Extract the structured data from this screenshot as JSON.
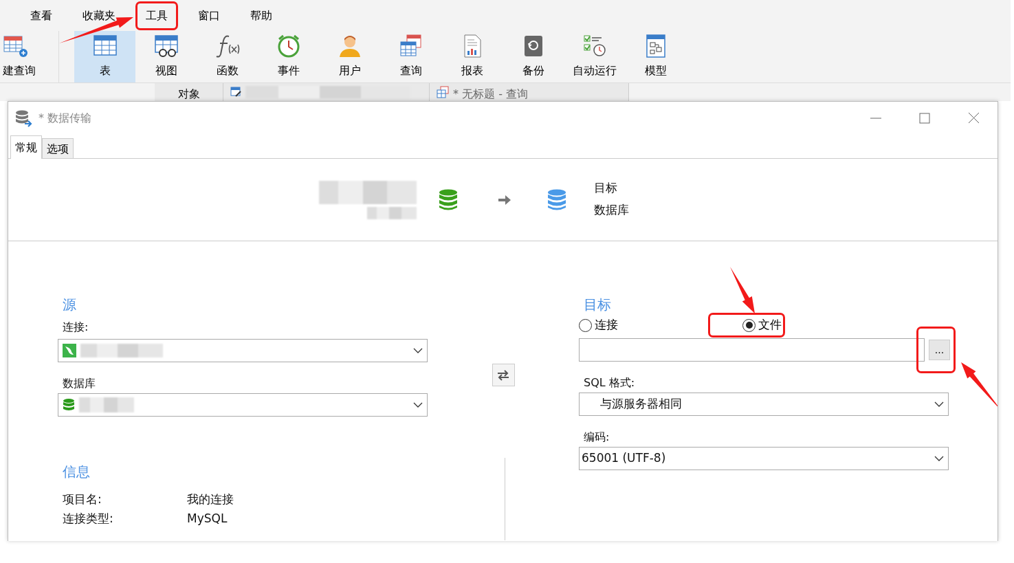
{
  "menu": [
    {
      "label": "查看",
      "callout": false
    },
    {
      "label": "收藏夹",
      "callout": false
    },
    {
      "label": "工具",
      "callout": true
    },
    {
      "label": "窗口",
      "callout": false
    },
    {
      "label": "帮助",
      "callout": false
    }
  ],
  "toolbar": [
    {
      "label": "建查询",
      "kind": "newquery",
      "selected": false
    },
    {
      "label": "表",
      "kind": "table",
      "selected": true
    },
    {
      "label": "视图",
      "kind": "view",
      "selected": false
    },
    {
      "label": "函数",
      "kind": "function",
      "selected": false
    },
    {
      "label": "事件",
      "kind": "event",
      "selected": false
    },
    {
      "label": "用户",
      "kind": "user",
      "selected": false
    },
    {
      "label": "查询",
      "kind": "query",
      "selected": false
    },
    {
      "label": "报表",
      "kind": "report",
      "selected": false
    },
    {
      "label": "备份",
      "kind": "backup",
      "selected": false
    },
    {
      "label": "自动运行",
      "kind": "schedule",
      "selected": false
    },
    {
      "label": "模型",
      "kind": "model",
      "selected": false
    }
  ],
  "doc_tabs": [
    {
      "kind": "text",
      "label": "对象"
    },
    {
      "kind": "redacted"
    },
    {
      "kind": "query",
      "label": "* 无标题 - 查询"
    }
  ],
  "dialog": {
    "title": "* 数据传输",
    "tabs": [
      {
        "label": "常规",
        "selected": true
      },
      {
        "label": "选项",
        "selected": false
      }
    ],
    "header": {
      "target_label": "目标",
      "target_type": "数据库"
    },
    "source": {
      "heading": "源",
      "connection_label": "连接:",
      "database_label": "数据库"
    },
    "target": {
      "heading": "目标",
      "modes": [
        {
          "label": "连接",
          "selected": false,
          "callout": false
        },
        {
          "label": "文件",
          "selected": true,
          "callout": true
        }
      ],
      "browse": {
        "label": "...",
        "callout": true
      },
      "sql_format_label": "SQL 格式:",
      "sql_format": "与源服务器相同",
      "encoding_label": "编码:",
      "encoding": "65001 (UTF-8)"
    },
    "info": {
      "heading": "信息",
      "rows": [
        {
          "label": "项目名:",
          "value": "我的连接"
        },
        {
          "label": "连接类型:",
          "value": "MySQL"
        }
      ]
    }
  }
}
